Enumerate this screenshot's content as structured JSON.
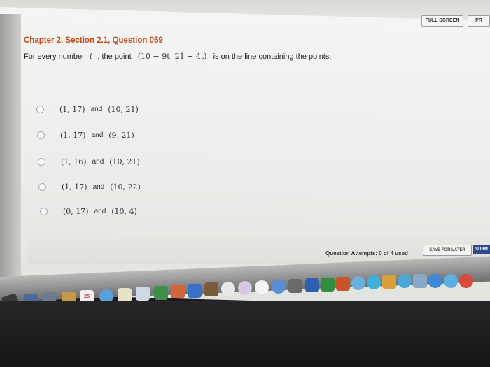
{
  "toolbar": {
    "fullscreen_label": "FULL SCREEN",
    "print_label": "PR"
  },
  "question": {
    "title": "Chapter 2, Section 2.1, Question 059",
    "prompt_pre": "For every number",
    "variable": "t",
    "prompt_mid": ", the point",
    "point_expr": "(10 − 9t, 21 − 4t)",
    "prompt_post": "is on the line containing the points:"
  },
  "options": [
    {
      "p1": "(1, 17)",
      "joiner": "and",
      "p2": "(10, 21)"
    },
    {
      "p1": "(1, 17)",
      "joiner": "and",
      "p2": "(9, 21)"
    },
    {
      "p1": "(1, 16)",
      "joiner": "and",
      "p2": "(10, 21)"
    },
    {
      "p1": "(1, 17)",
      "joiner": "and",
      "p2": "(10, 22)"
    },
    {
      "p1": "(0, 17)",
      "joiner": "and",
      "p2": "(10, 4)"
    }
  ],
  "footer": {
    "attempts_text": "Question Attempts: 0 of 4 used",
    "save_label": "SAVE FOR LATER",
    "submit_label": "SUBM"
  },
  "dock": {
    "calendar_day": "25"
  },
  "colors": {
    "title": "#c24a1a",
    "submit": "#2c4d8a"
  }
}
